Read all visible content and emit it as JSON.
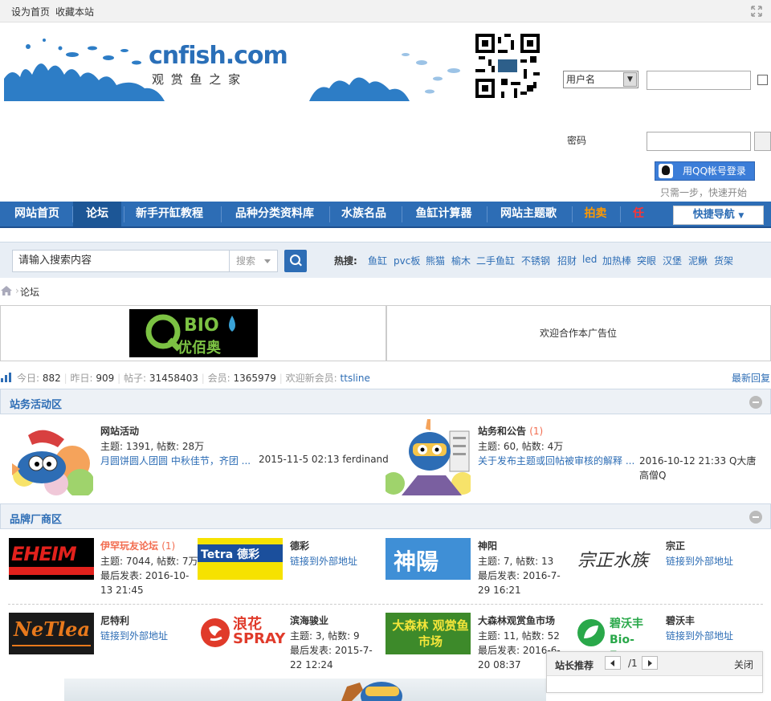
{
  "topbar": {
    "set_home": "设为首页",
    "favorite": "收藏本站"
  },
  "header": {
    "logo_text": "cnfish.com",
    "logo_sub": "观 赏 鱼 之 家",
    "login": {
      "username_select": "用户名",
      "password_label": "密码",
      "qq_login": "用QQ帐号登录",
      "qq_hint": "只需一步，快速开始"
    }
  },
  "nav": {
    "items": [
      {
        "label": "网站首页",
        "color": "#ffffff"
      },
      {
        "label": "论坛",
        "color": "#ffffff"
      },
      {
        "label": "新手开缸教程",
        "color": "#ffffff"
      },
      {
        "label": "品种分类资料库",
        "color": "#ffffff"
      },
      {
        "label": "水族名品",
        "color": "#ffffff"
      },
      {
        "label": "鱼缸计算器",
        "color": "#ffffff"
      },
      {
        "label": "网站主题歌",
        "color": "#ffffff"
      },
      {
        "label": "拍卖",
        "color": "#ff9900"
      },
      {
        "label": "任",
        "color": "#ff3333"
      }
    ],
    "quick_nav": "快捷导航"
  },
  "search": {
    "placeholder": "请输入搜索内容",
    "type": "搜索",
    "hot_label": "热搜:",
    "hot": [
      "鱼缸",
      "pvc板",
      "熊猫",
      "榆木",
      "二手鱼缸",
      "不锈钢",
      "招财",
      "led",
      "加热棒",
      "突眼",
      "汉堡",
      "泥鳅",
      "货架"
    ]
  },
  "breadcrumb": {
    "current": "论坛"
  },
  "ad": {
    "brand": "优佰奥",
    "brand_latin": "Q BIO",
    "right_text": "欢迎合作本广告位"
  },
  "stats": {
    "today_label": "今日:",
    "today": "882",
    "yesterday_label": "昨日:",
    "yesterday": "909",
    "posts_label": "帖子:",
    "posts": "31458403",
    "members_label": "会员:",
    "members": "1365979",
    "new_member_label": "欢迎新会员:",
    "new_member": "ttsline",
    "latest_reply": "最新回复"
  },
  "sections": {
    "activity": {
      "title": "站务活动区",
      "forums": [
        {
          "name": "网站活动",
          "new": "",
          "meta": "主题: 1391, 帖数: 28万",
          "last_title": "月圆饼圆人团圆 中秋佳节，齐团 ...",
          "last_info": "2015-11-5 02:13 ferdinand"
        },
        {
          "name": "站务和公告",
          "new": "(1)",
          "meta": "主题: 60, 帖数: 4万",
          "last_title": "关于发布主题或回帖被审核的解释 ...",
          "last_info": "2016-10-12 21:33 Q大唐高僧Q"
        }
      ]
    },
    "brands": {
      "title": "品牌厂商区",
      "forums": [
        {
          "name": "伊罕玩友论坛",
          "new": "(1)",
          "meta1": "主题: 7044, 帖数: 7万",
          "meta2": "最后发表: 2016-10-13 21:45",
          "brand_text": "EHEIM"
        },
        {
          "name": "德彩",
          "link": "链接到外部地址",
          "brand_text": "Tetra 德彩"
        },
        {
          "name": "神阳",
          "meta1": "主题: 7, 帖数: 13",
          "meta2": "最后发表: 2016-7-29 16:21",
          "brand_text": "神陽"
        },
        {
          "name": "宗正",
          "link": "链接到外部地址",
          "brand_text": "宗正水族"
        },
        {
          "name": "尼特利",
          "link": "链接到外部地址",
          "brand_text": "NeTlea"
        },
        {
          "name": "滨海骏业",
          "meta1": "主题: 3, 帖数: 9",
          "meta2": "最后发表: 2015-7-22 12:24",
          "brand_text": "浪花 SPRAY"
        },
        {
          "name": "大森林观赏鱼市场",
          "meta1": "主题: 11, 帖数: 52",
          "meta2": "最后发表: 2016-6-20 08:37",
          "brand_text": "大森林 观赏鱼市场"
        },
        {
          "name": "碧沃丰",
          "link": "链接到外部地址",
          "brand_text": "碧沃丰 Bio-Form"
        }
      ]
    }
  },
  "floatbox": {
    "title": "站长推荐",
    "page": "/1",
    "close": "关闭"
  }
}
